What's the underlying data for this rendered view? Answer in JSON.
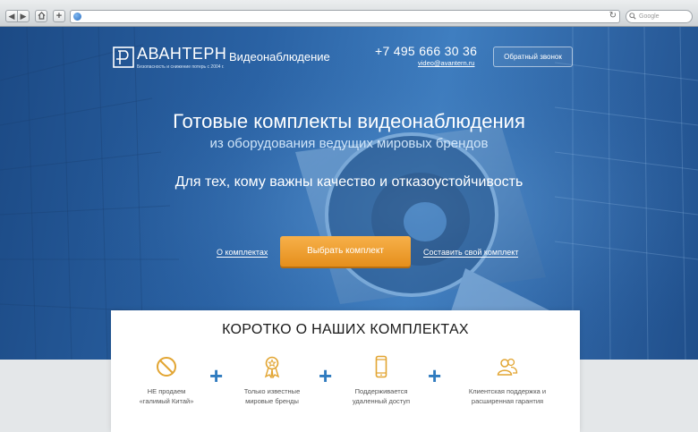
{
  "browser": {
    "back_icon": "chevron-left-icon",
    "forward_icon": "chevron-right-icon",
    "home_icon": "home-icon",
    "new_tab_icon": "plus-icon",
    "search_placeholder": "Google"
  },
  "header": {
    "logo_name": "АВАНТЕРН",
    "logo_tagline": "Безопасность и снижение потерь с 2004 г.",
    "service": "Видеонаблюдение",
    "phone": "+7 495 666 30 36",
    "email": "video@avantern.ru",
    "callback_label": "Обратный звонок"
  },
  "hero": {
    "title": "Готовые комплекты видеонаблюдения",
    "subtitle": "из оборудования ведущих мировых брендов",
    "tagline": "Для тех, кому важны качество и отказоустойчивость",
    "link_about": "О комплектах",
    "cta_label": "Выбрать комплект",
    "link_custom": "Составить свой комплект"
  },
  "features": {
    "title": "КОРОТКО О НАШИХ КОМПЛЕКТАХ",
    "items": [
      {
        "icon": "no-sign-icon",
        "text": "НЕ продаем\n«галимый Китай»"
      },
      {
        "icon": "award-ribbon-icon",
        "text": "Только известные\nмировые бренды"
      },
      {
        "icon": "smartphone-icon",
        "text": "Поддерживается\nудаленный доступ"
      },
      {
        "icon": "users-icon",
        "text": "Клиентская поддержка и\nрасширенная гарантия"
      }
    ],
    "separator": "+"
  },
  "colors": {
    "accent_orange": "#f2a13a",
    "icon_gold": "#e2a532",
    "plus_blue": "#2f7bbf",
    "hero_blue": "#2a62a4"
  }
}
